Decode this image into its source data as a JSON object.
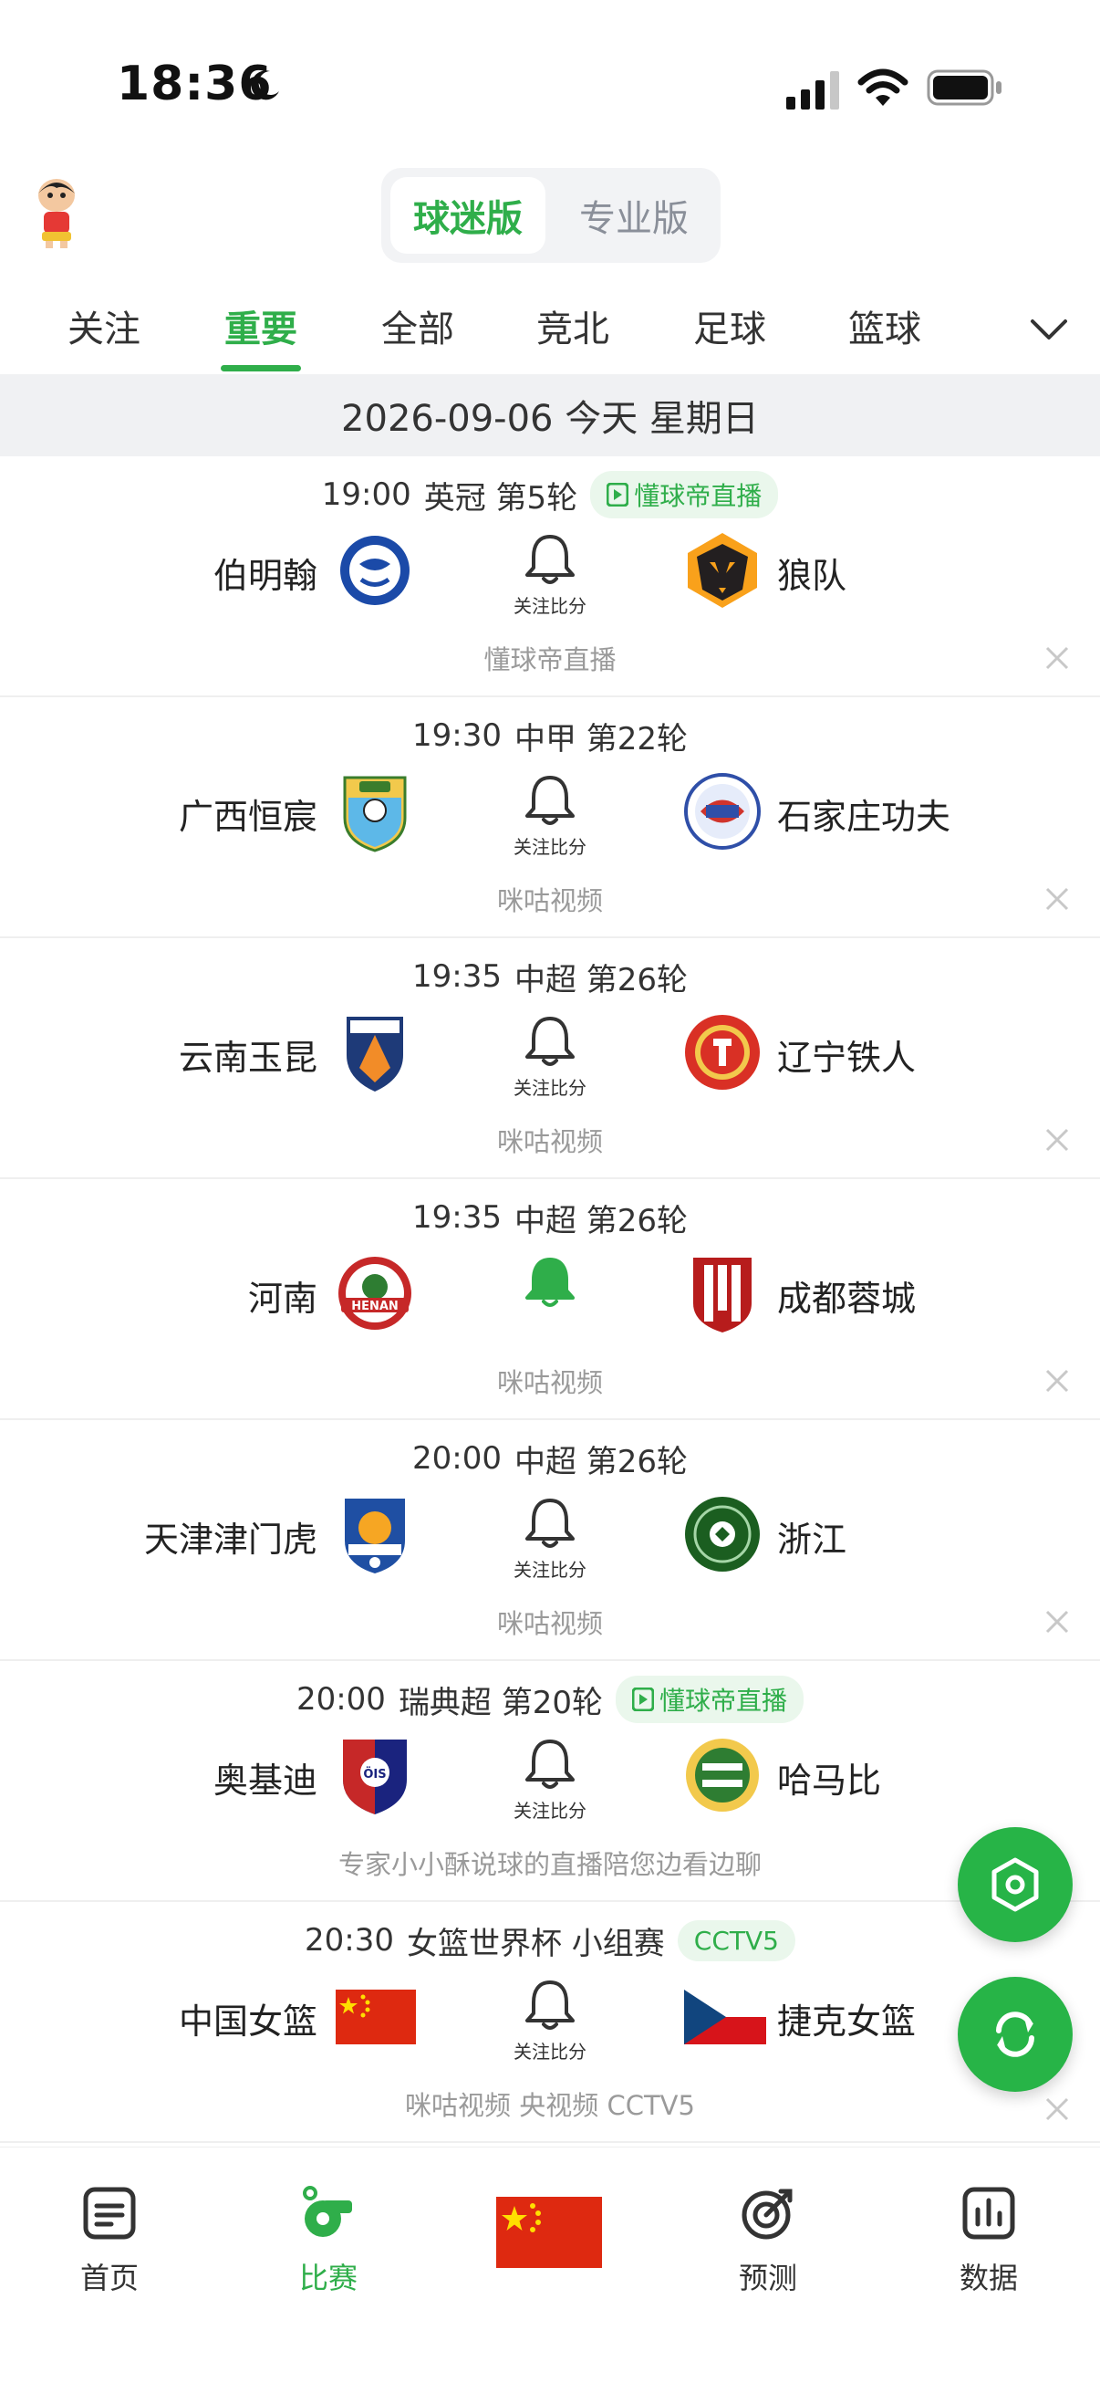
{
  "status_bar": {
    "time": "18:36"
  },
  "header": {
    "segment": {
      "active": "球迷版",
      "inactive": "专业版"
    }
  },
  "tabs": [
    "关注",
    "重要",
    "全部",
    "竞北",
    "足球",
    "篮球"
  ],
  "active_tab": "重要",
  "date_bar": "2026-09-06 今天 星期日",
  "bell_label": "关注比分",
  "matches": [
    {
      "time": "19:00",
      "league": "英冠 第5轮",
      "channel_badge": "懂球帝直播",
      "home": "伯明翰",
      "away": "狼队",
      "footer": "懂球帝直播",
      "followed": false
    },
    {
      "time": "19:30",
      "league": "中甲 第22轮",
      "channel_badge": "",
      "home": "广西恒宸",
      "away": "石家庄功夫",
      "footer": "咪咕视频",
      "followed": false
    },
    {
      "time": "19:35",
      "league": "中超 第26轮",
      "channel_badge": "",
      "home": "云南玉昆",
      "away": "辽宁铁人",
      "footer": "咪咕视频",
      "followed": false
    },
    {
      "time": "19:35",
      "league": "中超 第26轮",
      "channel_badge": "",
      "home": "河南",
      "away": "成都蓉城",
      "footer": "咪咕视频",
      "followed": true
    },
    {
      "time": "20:00",
      "league": "中超 第26轮",
      "channel_badge": "",
      "home": "天津津门虎",
      "away": "浙江",
      "footer": "咪咕视频",
      "followed": false
    },
    {
      "time": "20:00",
      "league": "瑞典超 第20轮",
      "channel_badge": "懂球帝直播",
      "home": "奥基迪",
      "away": "哈马比",
      "footer": "专家小小酥说球的直播陪您边看边聊",
      "followed": false
    },
    {
      "time": "20:30",
      "league": "女篮世界杯 小组赛",
      "channel_badge": "CCTV5",
      "home": "中国女篮",
      "away": "捷克女篮",
      "footer": "咪咕视频 央视频 CCTV5",
      "followed": false
    }
  ],
  "bottom_nav": [
    {
      "label": "首页",
      "icon": "home-doc-icon"
    },
    {
      "label": "比赛",
      "icon": "whistle-icon"
    },
    {
      "label": "",
      "icon": "china-flag-icon"
    },
    {
      "label": "预测",
      "icon": "target-icon"
    },
    {
      "label": "数据",
      "icon": "bar-chart-icon"
    }
  ],
  "colors": {
    "accent": "#2fae4a",
    "fab": "#27b447",
    "date_bar_bg": "#f0f1f3"
  }
}
